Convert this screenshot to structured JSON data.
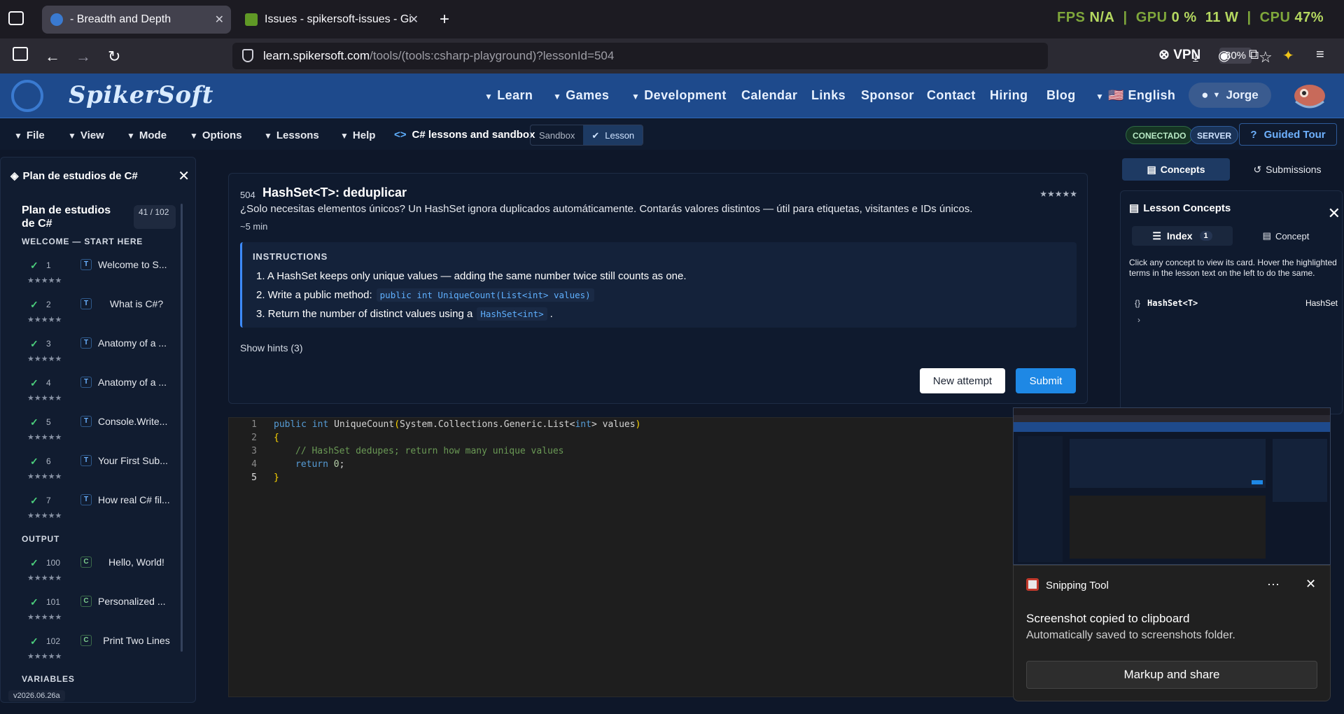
{
  "browser": {
    "tabs": [
      {
        "title": "- Breadth and Depth",
        "active": true
      },
      {
        "title": "Issues - spikersoft-issues - Gitea",
        "active": false
      }
    ],
    "stats": {
      "fps_label": "FPS",
      "fps_value": "N/A",
      "gpu_label": "GPU",
      "gpu_value": "0 %",
      "gpu_power": "11 W",
      "cpu_label": "CPU",
      "cpu_value": "47%"
    },
    "url_domain": "learn.spikersoft.com",
    "url_path": "/tools/(tools:csharp-playground)?lessonId=504",
    "zoom": "80%",
    "vpn_label": "VPN"
  },
  "site": {
    "brand": "SpikerSoft",
    "nav": [
      {
        "label": "Learn",
        "caret": true
      },
      {
        "label": "Games",
        "caret": true
      },
      {
        "label": "Development",
        "caret": true
      },
      {
        "label": "Calendar",
        "caret": false
      },
      {
        "label": "Links",
        "caret": false
      },
      {
        "label": "Sponsor",
        "caret": false
      },
      {
        "label": "Contact",
        "caret": false
      },
      {
        "label": "Hiring",
        "caret": false
      },
      {
        "label": "Blog",
        "caret": false
      },
      {
        "label": "🇺🇸 English",
        "caret": true
      }
    ],
    "user": "Jorge"
  },
  "menubar": {
    "items": [
      "File",
      "View",
      "Mode",
      "Options",
      "Lessons",
      "Help"
    ],
    "crumb_icon": "<>",
    "crumb": "C# lessons and sandbox",
    "modes": {
      "sandbox": "Sandbox",
      "lesson": "Lesson"
    },
    "status_conn": "CONECTADO",
    "status_server": "SERVER",
    "guided_tour": "Guided Tour"
  },
  "sidebar": {
    "header": "Plan de estudios de C#",
    "card_title": "Plan de estudios de C#",
    "progress": "41 / 102",
    "sections": [
      {
        "title": "WELCOME — START HERE"
      },
      {
        "title": "OUTPUT"
      },
      {
        "title": "VARIABLES"
      }
    ],
    "lessons": [
      {
        "num": "1",
        "badge": "T",
        "title": "Welcome to S...",
        "stars": "★★★★★"
      },
      {
        "num": "2",
        "badge": "T",
        "title": "What is C#?",
        "stars": "★★★★★"
      },
      {
        "num": "3",
        "badge": "T",
        "title": "Anatomy of a ...",
        "stars": "★★★★★"
      },
      {
        "num": "4",
        "badge": "T",
        "title": "Anatomy of a ...",
        "stars": "★★★★★"
      },
      {
        "num": "5",
        "badge": "T",
        "title": "Console.Write...",
        "stars": "★★★★★"
      },
      {
        "num": "6",
        "badge": "T",
        "title": "Your First Sub...",
        "stars": "★★★★★"
      },
      {
        "num": "7",
        "badge": "T",
        "title": "How real C# fil...",
        "stars": "★★★★★"
      },
      {
        "num": "100",
        "badge": "C",
        "title": "Hello, World!",
        "stars": "★★★★★"
      },
      {
        "num": "101",
        "badge": "C",
        "title": "Personalized ...",
        "stars": "★★★★★"
      },
      {
        "num": "102",
        "badge": "C",
        "title": "Print Two Lines",
        "stars": "★★★★★"
      }
    ],
    "version": "v2026.06.26a"
  },
  "lesson": {
    "number": "504",
    "title": "HashSet<T>: deduplicar",
    "rating": "★★★★★",
    "description": "¿Solo necesitas elementos únicos? Un HashSet ignora duplicados automáticamente. Contarás valores distintos — útil para etiquetas, visitantes e IDs únicos.",
    "duration": "~5 min",
    "instructions_heading": "INSTRUCTIONS",
    "steps": [
      {
        "text": "1. A HashSet keeps only unique values — adding the same number twice still counts as one.",
        "code": "",
        "tail": ""
      },
      {
        "text": "2. Write a public method:",
        "code": "public int UniqueCount(List<int> values)",
        "tail": ""
      },
      {
        "text": "3. Return the number of distinct values using a",
        "code": "HashSet<int>",
        "tail": "."
      }
    ],
    "hints": "Show hints (3)",
    "new_attempt": "New attempt",
    "submit": "Submit"
  },
  "editor": {
    "lines": [
      {
        "n": "1"
      },
      {
        "n": "2"
      },
      {
        "n": "3"
      },
      {
        "n": "4"
      },
      {
        "n": "5"
      }
    ],
    "code": {
      "l1_kw1": "public",
      "l1_kw2": "int",
      "l1_name": "UniqueCount",
      "l1_paren": "(",
      "l1_ns": "System.Collections.Generic.List<",
      "l1_ty": "int",
      "l1_rest": "> values",
      "l1_close": ")",
      "l2": "{",
      "l3": "// HashSet dedupes; return how many unique values",
      "l4_kw": "return",
      "l4_num": "0",
      "l4_semi": ";",
      "l5": "}"
    }
  },
  "concepts": {
    "tab_concepts": "Concepts",
    "tab_submissions": "Submissions",
    "title": "Lesson Concepts",
    "index_label": "Index",
    "index_count": "1",
    "concept_label": "Concept",
    "help": "Click any concept to view its card. Hover the highlighted terms in the lesson text on the left to do the same.",
    "items": [
      {
        "name": "HashSet<T>",
        "tag": "HashSet"
      }
    ]
  },
  "toast": {
    "app": "Snipping Tool",
    "heading": "Screenshot copied to clipboard",
    "sub": "Automatically saved to screenshots folder.",
    "button": "Markup and share"
  },
  "colors": {
    "accent": "#1e88e5",
    "header": "#1e4a8c",
    "success": "#4cd07d"
  }
}
